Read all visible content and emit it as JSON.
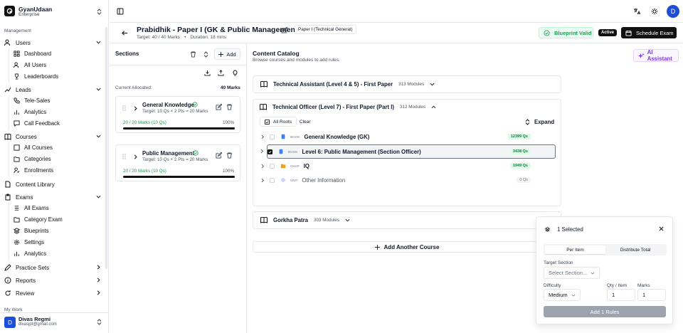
{
  "brand": {
    "name": "GyanUdaan",
    "plan": "Enterprise"
  },
  "sidebar": {
    "group_label": "Management",
    "users": {
      "label": "Users",
      "items": [
        "Dashboard",
        "All Users",
        "Leaderboards"
      ]
    },
    "leads": {
      "label": "Leads",
      "items": [
        "Tele-Sales",
        "Analytics",
        "Call Feedback"
      ]
    },
    "courses": {
      "label": "Courses",
      "items": [
        "All Courses",
        "Categories",
        "Enrollments"
      ]
    },
    "content_library": "Content Library",
    "exams": {
      "label": "Exams",
      "items": [
        "All Exams",
        "Category Exam",
        "Blueprints",
        "Settings",
        "Analytics"
      ]
    },
    "practice_sets": "Practice Sets",
    "reports": "Reports",
    "review": "Review",
    "group2_label": "My Work",
    "user": {
      "initial": "D",
      "name": "Divas Regmi",
      "email": "divasjpt@gmail.com"
    }
  },
  "header": {
    "avatar": "D"
  },
  "exam": {
    "title": "Prabidhik - Paper I (GK & Public Management)",
    "target": "Target: 40 / 40 Marks",
    "dot": "•",
    "duration": "Duration: 18 mins",
    "tag": "Paper I (Technical General)",
    "valid": "Blueprint Valid",
    "status": "Active",
    "schedule": "Schedule Exam"
  },
  "sections": {
    "header": "Sections",
    "add": "Add",
    "allocated_label": "Current Allocated:",
    "allocated_value": "40 Marks",
    "items": [
      {
        "name": "General Knowledge",
        "target": "Target: 10 Qs × 2 Pts = 20 Marks",
        "progress_text": "20 / 20 Marks (10 Qs)",
        "percent_text": "100%",
        "progress": 1.0
      },
      {
        "name": "Public Management",
        "target": "Target: 10 Qs × 2 Pts = 20 Marks",
        "progress_text": "20 / 20 Marks (10 Qs)",
        "percent_text": "100%",
        "progress": 1.0
      }
    ]
  },
  "catalog": {
    "title": "Content Catalog",
    "subtitle": "Browse courses and modules to add rules.",
    "ai": "AI Assistant",
    "courses": [
      {
        "name": "Technical Assistant (Level 4 & 5) - First Paper",
        "modules": "313 Modules"
      },
      {
        "name": "Technical Officer (Level 7) - First Paper (Part I)",
        "modules": "312 Modules"
      },
      {
        "name": "Gorkha Patra",
        "modules": "303 Modules"
      }
    ],
    "all_roots": "All Roots",
    "clear": "Clear",
    "expand": "Expand",
    "rows": [
      {
        "kind": "BOOK",
        "name": "General Knowledge (GK)",
        "qs": "12399 Qs"
      },
      {
        "kind": "BOOK",
        "name": "Level 6: Public Management (Section Officer)",
        "qs": "3438 Qs"
      },
      {
        "kind": "CHAP",
        "name": "IQ",
        "qs": "1949 Qs"
      },
      {
        "kind": "UNIT",
        "name": "Other Information",
        "qs": "0 Qs"
      }
    ],
    "add_course": "Add Another Course"
  },
  "bulk": {
    "selected": "1 Selected",
    "tab_per_item": "Per Item",
    "tab_distribute": "Distribute Total",
    "target_label": "Target Section",
    "target_placeholder": "Select Section...",
    "difficulty_label": "Difficulty",
    "difficulty_value": "Medium",
    "qty_label": "Qty / Item",
    "qty_value": "1",
    "marks_label": "Marks",
    "marks_value": "1",
    "submit": "Add 1 Rules"
  }
}
